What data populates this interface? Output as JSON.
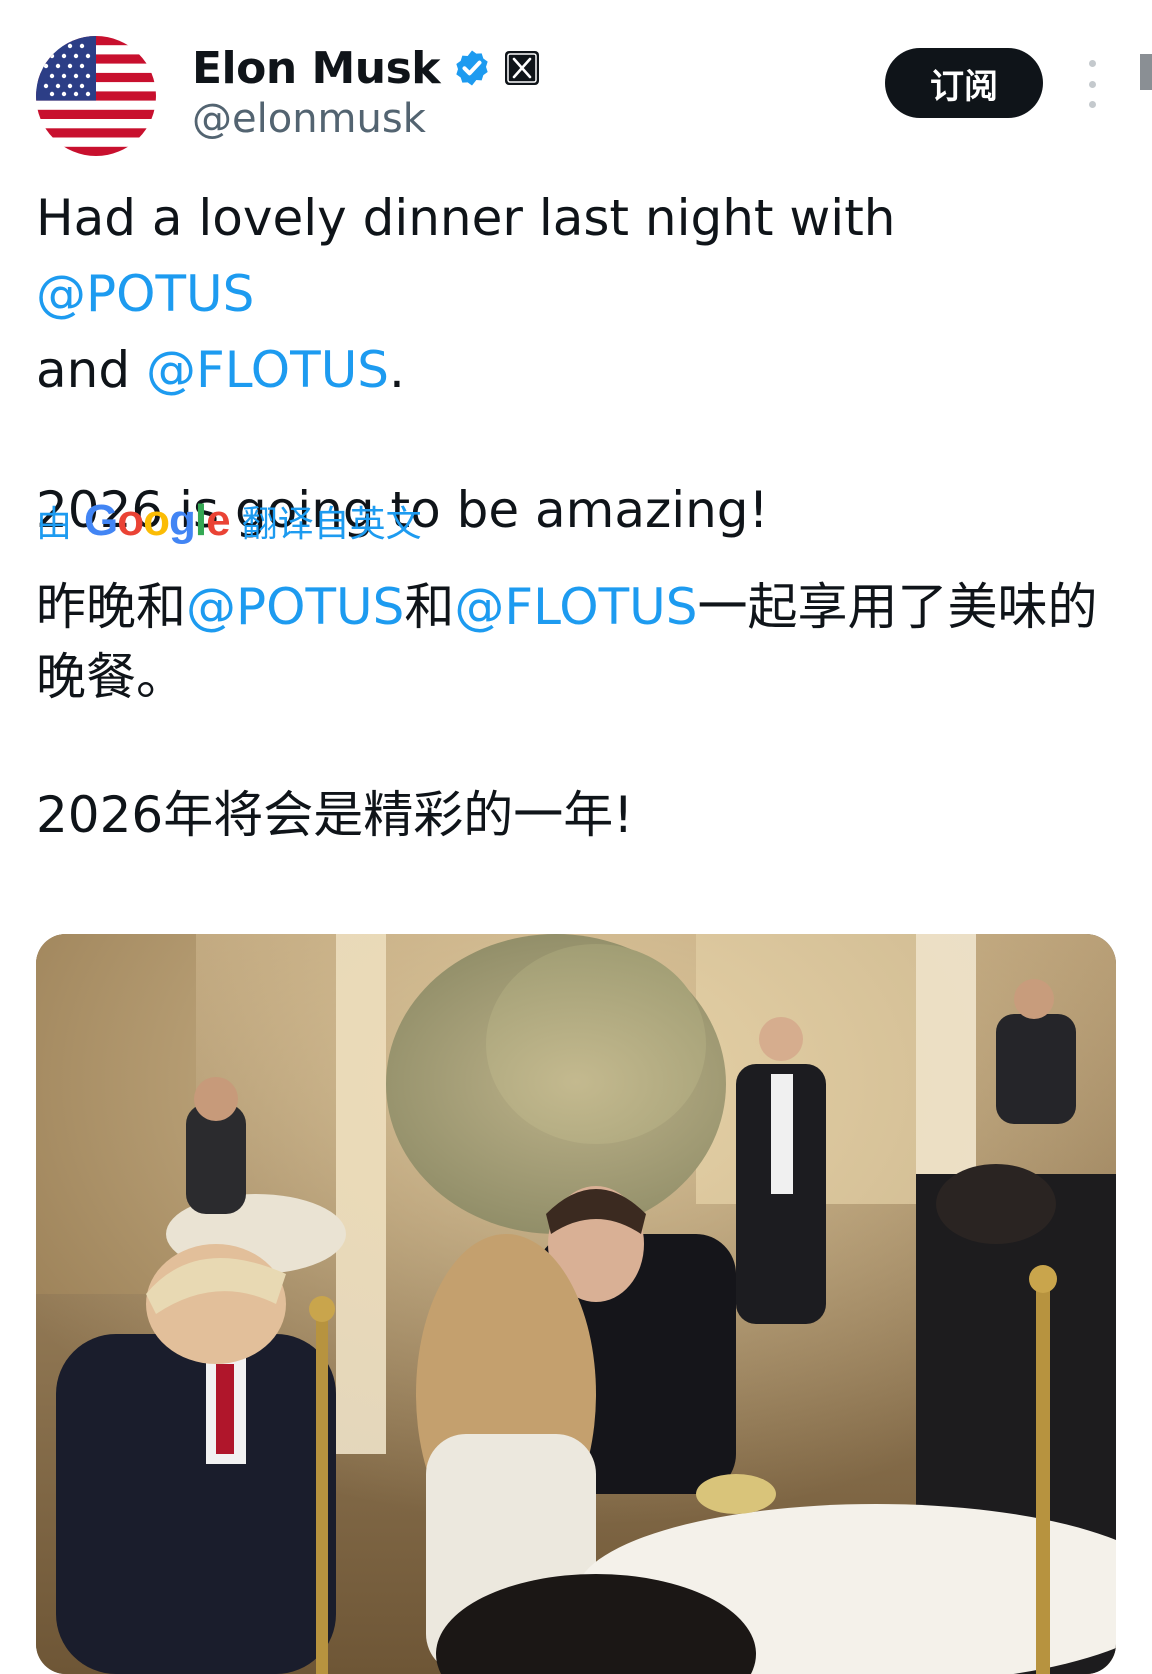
{
  "author": {
    "display_name": "Elon Musk",
    "handle": "@elonmusk",
    "avatar_icon": "us-flag-avatar",
    "verified_icon": "verified-badge-icon",
    "affiliate_icon": "x-logo-icon"
  },
  "header": {
    "subscribe_label": "订阅",
    "more_icon": "more-vertical-icon"
  },
  "tweet": {
    "line1_pre": "Had a lovely dinner last night with ",
    "mention1": "@POTUS",
    "line2_pre": "and ",
    "mention2": "@FLOTUS",
    "line2_post": ".",
    "line3": "2026 is going to be amazing!"
  },
  "translation": {
    "by_label": "由",
    "provider": "Google",
    "suffix_label": "翻译自英文",
    "p1_pre": "昨晚和",
    "mention1": "@POTUS",
    "p1_mid": "和",
    "mention2": "@FLOTUS",
    "p1_post": "一起享用了美味的晚餐。",
    "p2": "2026年将会是精彩的一年!"
  },
  "colors": {
    "mention": "#1d9bf0",
    "button_bg": "#0f1419",
    "handle": "#536471"
  }
}
